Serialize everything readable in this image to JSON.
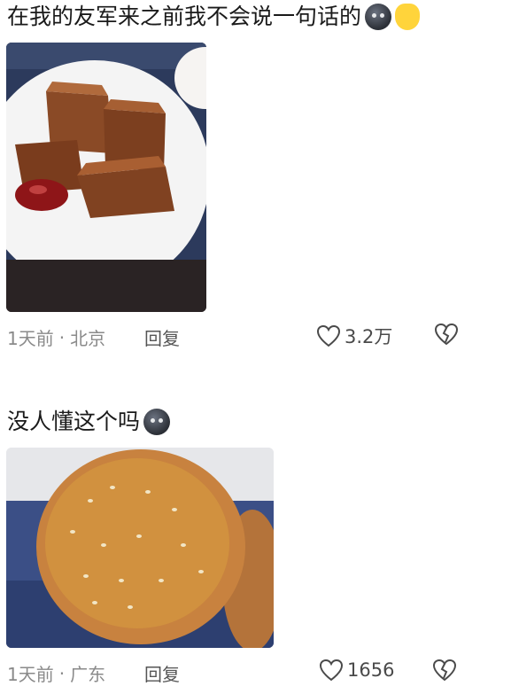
{
  "comments": [
    {
      "text": "在我的友军来之前我不会说一句话的",
      "emojis": [
        "dark-face-emoji",
        "waving-hand-emoji"
      ],
      "photo": "red date cakes on white plate",
      "time": "1天前",
      "separator": "·",
      "location": "北京",
      "reply_label": "回复",
      "likes": "3.2万"
    },
    {
      "text": "没人懂这个吗",
      "emojis": [
        "dark-face-emoji"
      ],
      "photo": "sesame walnut cookie",
      "time": "1天前",
      "separator": "·",
      "location": "广东",
      "reply_label": "回复",
      "likes": "1656"
    }
  ],
  "colors": {
    "background": "#ffffff",
    "meta_text": "#8a8a8a",
    "text": "#1a1a1a"
  }
}
